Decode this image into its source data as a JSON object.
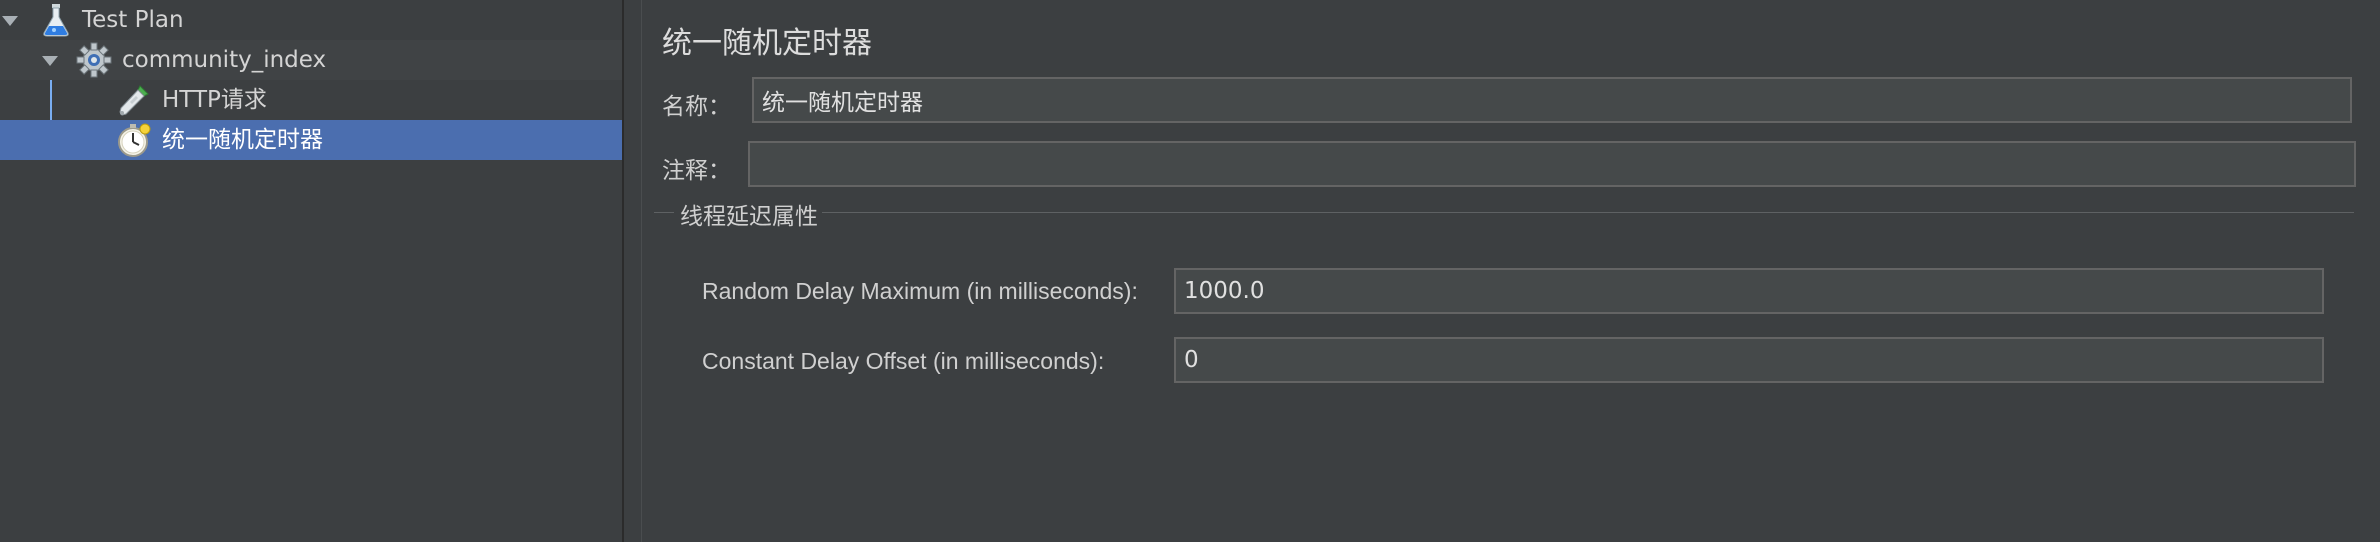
{
  "tree": {
    "items": [
      {
        "label": "Test Plan",
        "icon": "test-plan-flask-icon"
      },
      {
        "label": "community_index",
        "icon": "thread-group-gear-icon"
      },
      {
        "label": "HTTP请求",
        "icon": "http-sampler-pipette-icon"
      },
      {
        "label": "统一随机定时器",
        "icon": "timer-stopwatch-icon"
      }
    ],
    "selected_index": 3
  },
  "panel": {
    "title": "统一随机定时器",
    "name_label": "名称：",
    "name_value": "统一随机定时器",
    "comment_label": "注释：",
    "comment_value": "",
    "group_title": "线程延迟属性",
    "random_delay_label": "Random Delay Maximum (in milliseconds):",
    "random_delay_value": "1000.0",
    "constant_offset_label": "Constant Delay Offset (in milliseconds):",
    "constant_offset_value": "0"
  },
  "colors": {
    "background": "#3c3f41",
    "selection": "#4b6eaf",
    "field": "#45494a",
    "tree_line": "#7aaef2"
  }
}
